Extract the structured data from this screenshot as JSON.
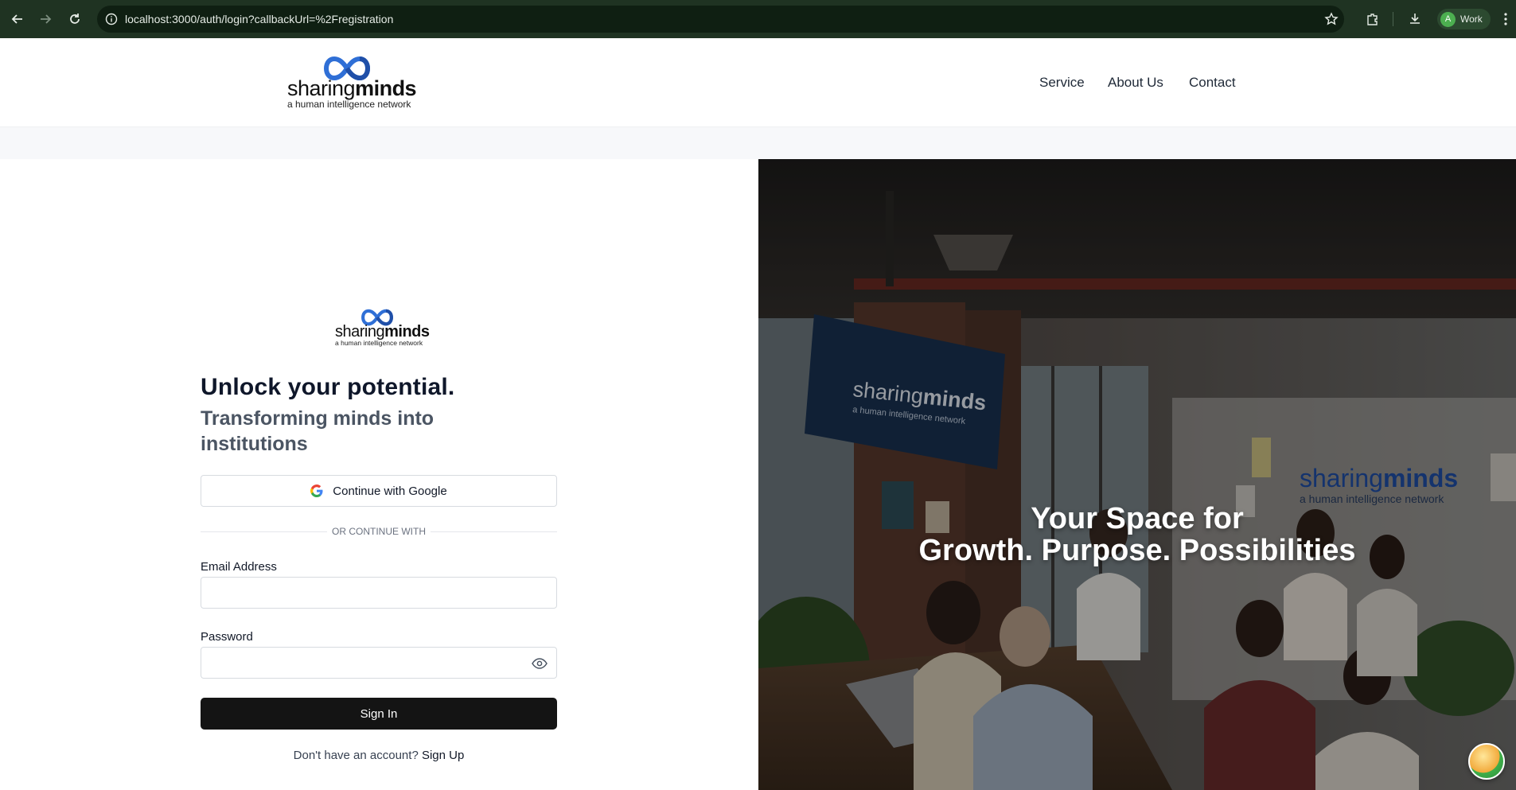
{
  "browser": {
    "url": "localhost:3000/auth/login?callbackUrl=%2Fregistration",
    "profile_initial": "A",
    "profile_label": "Work",
    "icons": [
      "back-icon",
      "forward-icon",
      "reload-icon",
      "site-info-icon",
      "bookmark-star-icon",
      "extensions-icon",
      "download-icon",
      "menu-icon"
    ]
  },
  "header": {
    "logo": {
      "word_light": "sharing",
      "word_bold": "minds",
      "tagline": "a human intelligence network"
    },
    "nav": [
      {
        "label": "Service"
      },
      {
        "label": "About Us"
      },
      {
        "label": "Contact"
      }
    ]
  },
  "login": {
    "logo": {
      "word_light": "sharing",
      "word_bold": "minds",
      "tagline": "a human intelligence network"
    },
    "headline": "Unlock your potential.",
    "subheadline": "Transforming minds into institutions",
    "google_button": "Continue with Google",
    "divider_text": "OR CONTINUE WITH",
    "email_label": "Email Address",
    "email_value": "",
    "password_label": "Password",
    "password_value": "",
    "signin_button": "Sign In",
    "signup_prompt": "Don't have an account?",
    "signup_link": "Sign Up"
  },
  "hero": {
    "line1": "Your Space for",
    "line2": "Growth. Purpose. Possibilities",
    "tv_logo": {
      "word_light": "sharing",
      "word_bold": "minds",
      "tagline": "a human intelligence network"
    },
    "wall_logo": {
      "word_light": "sharing",
      "word_bold": "minds",
      "tagline": "a human intelligence network"
    }
  },
  "colors": {
    "chrome_bg": "#1f3322",
    "primary_button": "#141414",
    "logo_blue": "#2f6fd6",
    "heading": "#0f172a",
    "subheading": "#4b5563"
  }
}
